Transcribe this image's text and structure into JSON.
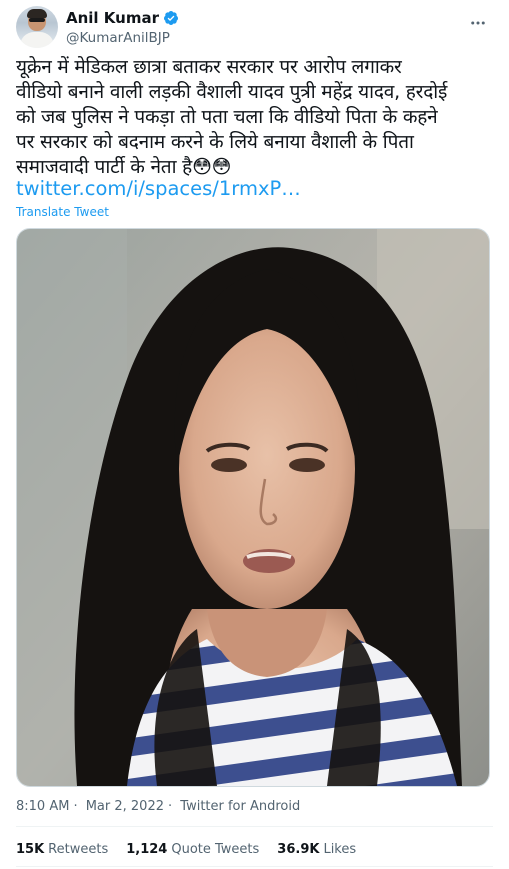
{
  "author": {
    "name": "Anil Kumar",
    "handle": "@KumarAnilBJP",
    "verified_icon": "verified-badge-icon",
    "more_icon": "more-options-icon"
  },
  "tweet": {
    "lines": [
      "यूक्रेन में मेडिकल छात्रा बताकर सरकार पर आरोप लगाकर",
      "वीडियो बनाने वाली लड़की वैशाली यादव पुत्री महेंद्र यादव, हरदोई",
      "को जब पुलिस ने पकड़ा तो पता चला कि वीडियो पिता के कहने",
      "पर सरकार को बदनाम करने के लिये बनाया वैशाली के पिता",
      "समाजवादी पार्टी के नेता है😳😳"
    ],
    "link": "twitter.com/i/spaces/1rmxP…",
    "translate": "Translate Tweet"
  },
  "meta": {
    "time": "8:10 AM",
    "sep": "·",
    "date": "Mar 2, 2022",
    "source": "Twitter for Android"
  },
  "stats": {
    "retweets_count": "15K",
    "retweets_label": "Retweets",
    "quotes_count": "1,124",
    "quotes_label": "Quote Tweets",
    "likes_count": "36.9K",
    "likes_label": "Likes"
  },
  "colors": {
    "accent": "#1d9bf0",
    "text": "#0f1419",
    "secondary": "#536471"
  }
}
